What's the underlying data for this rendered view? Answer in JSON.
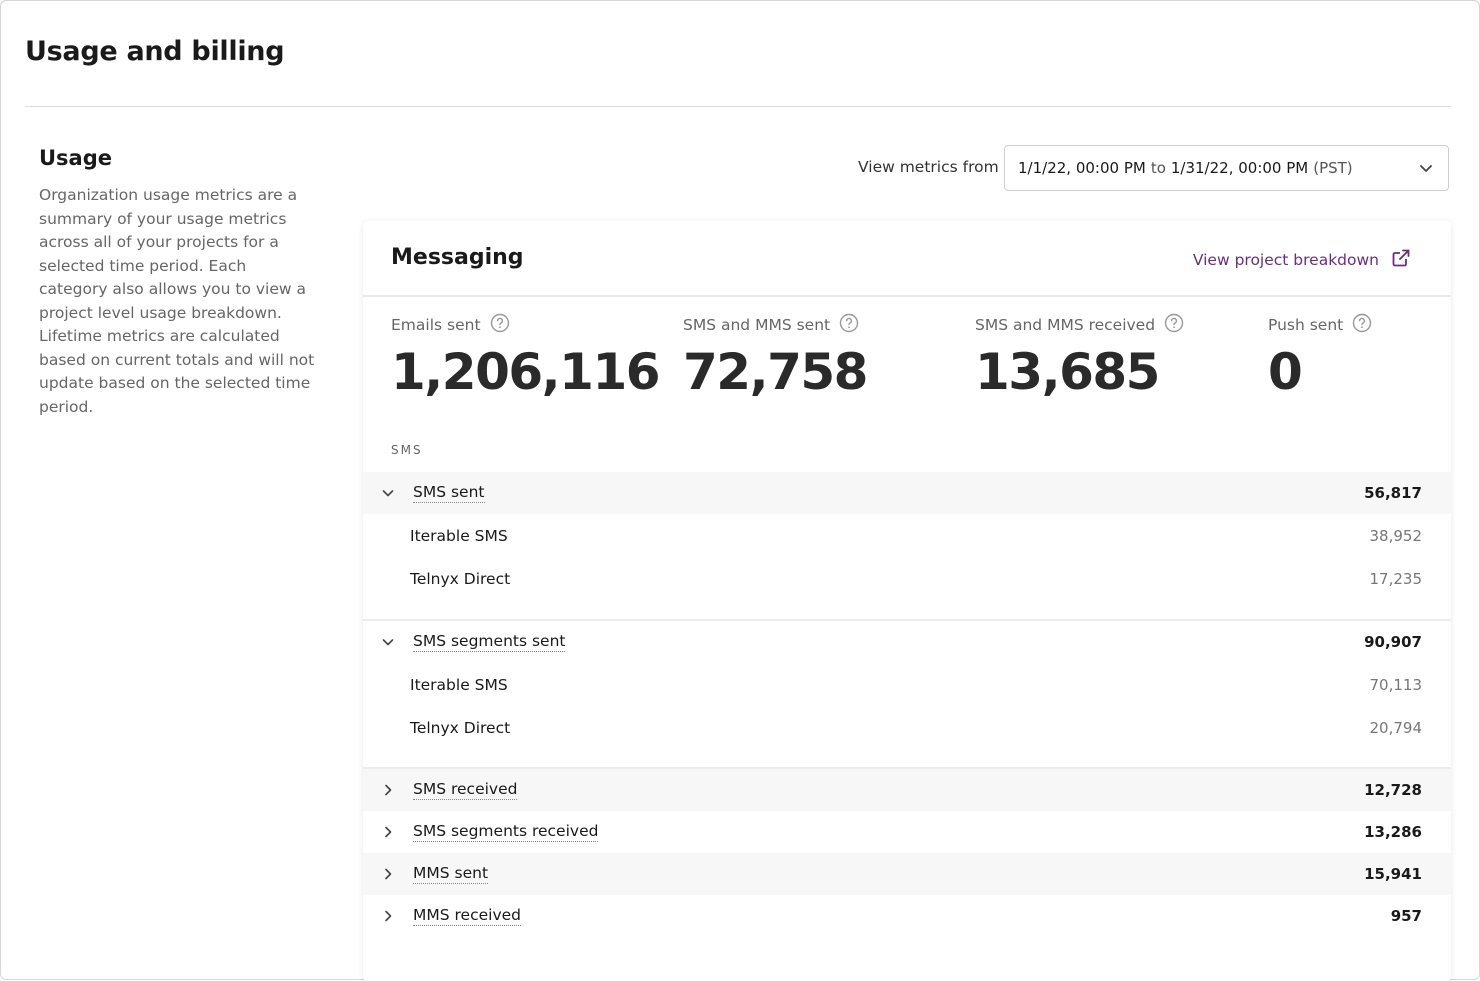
{
  "page": {
    "title": "Usage and billing"
  },
  "usage": {
    "heading": "Usage",
    "description": "Organization usage metrics are a summary of your usage metrics across all of your projects for a selected time period. Each category also allows you to view a project level usage breakdown. Lifetime metrics are calculated based on current totals and will not update based on the selected time period."
  },
  "date_filter": {
    "label": "View metrics from",
    "start": "1/1/22, 00:00 PM",
    "to": "to",
    "end": "1/31/22, 00:00 PM",
    "timezone": "(PST)"
  },
  "messaging": {
    "title": "Messaging",
    "breakdown_link": "View project breakdown",
    "metrics": [
      {
        "label": "Emails sent",
        "value": "1,206,116"
      },
      {
        "label": "SMS and MMS sent",
        "value": "72,758"
      },
      {
        "label": "SMS and MMS received",
        "value": "13,685"
      },
      {
        "label": "Push sent",
        "value": "0"
      }
    ],
    "section_label": "SMS",
    "groups": [
      {
        "label": "SMS sent",
        "value": "56,817",
        "expanded": true,
        "items": [
          {
            "label": "Iterable SMS",
            "value": "38,952"
          },
          {
            "label": "Telnyx Direct",
            "value": "17,235"
          }
        ]
      },
      {
        "label": "SMS segments sent",
        "value": "90,907",
        "expanded": true,
        "items": [
          {
            "label": "Iterable SMS",
            "value": "70,113"
          },
          {
            "label": "Telnyx Direct",
            "value": "20,794"
          }
        ]
      },
      {
        "label": "SMS received",
        "value": "12,728",
        "expanded": false
      },
      {
        "label": "SMS segments received",
        "value": "13,286",
        "expanded": false
      },
      {
        "label": "MMS sent",
        "value": "15,941",
        "expanded": false
      },
      {
        "label": "MMS received",
        "value": "957",
        "expanded": false
      }
    ]
  },
  "colors": {
    "link": "#6b2d83",
    "row_shade": "#f7f7f7",
    "muted_text": "#666666"
  },
  "icons": {
    "help": "help-circle-icon",
    "external": "external-link-icon",
    "select": "chevron-down-icon"
  }
}
